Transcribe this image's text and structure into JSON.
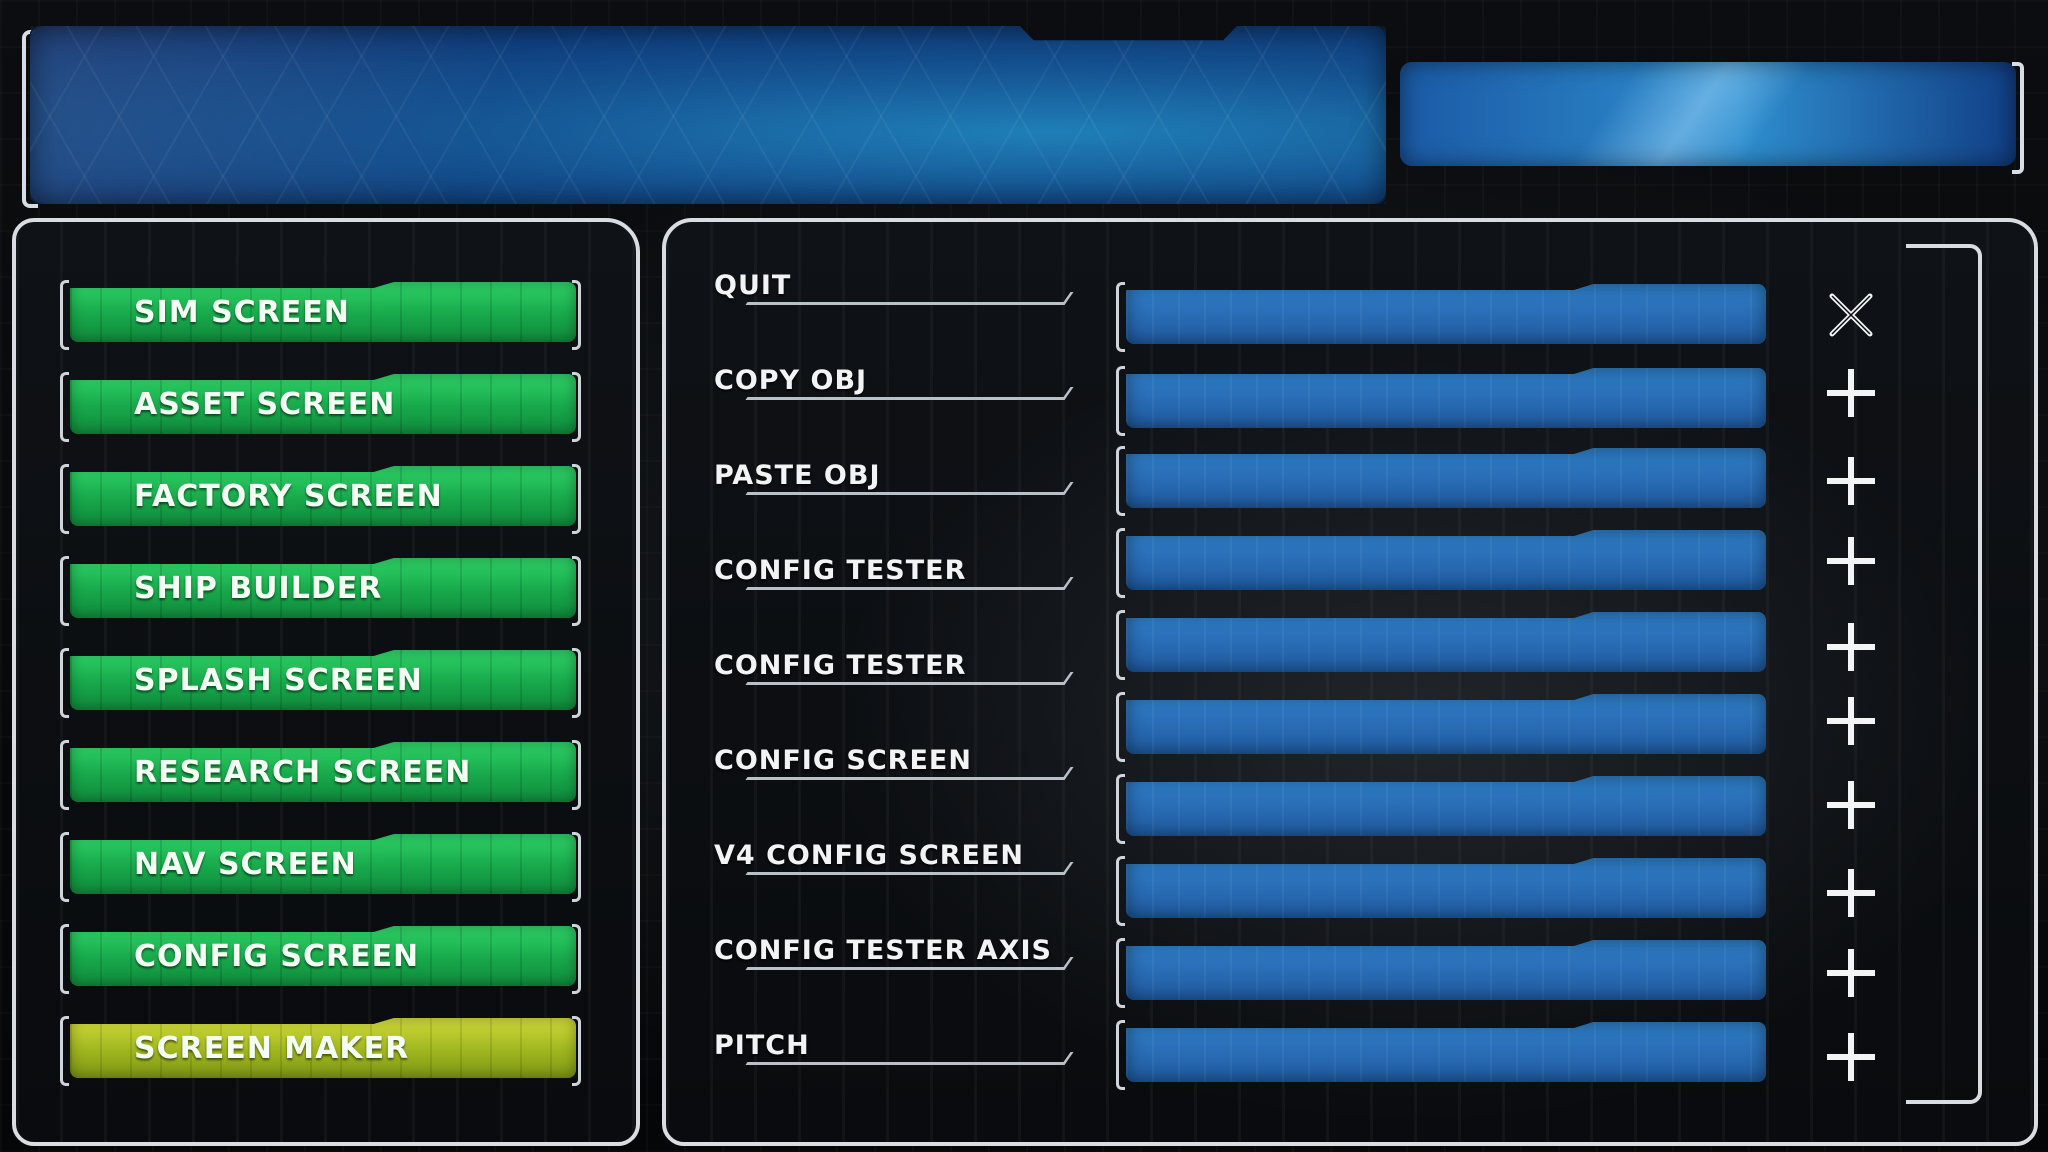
{
  "nav": {
    "items": [
      {
        "label": "SIM SCREEN",
        "active": false
      },
      {
        "label": "ASSET SCREEN",
        "active": false
      },
      {
        "label": "FACTORY SCREEN",
        "active": false
      },
      {
        "label": "SHIP BUILDER",
        "active": false
      },
      {
        "label": "SPLASH SCREEN",
        "active": false
      },
      {
        "label": "RESEARCH SCREEN",
        "active": false
      },
      {
        "label": "NAV SCREEN",
        "active": false
      },
      {
        "label": "CONFIG SCREEN",
        "active": false
      },
      {
        "label": "SCREEN MAKER",
        "active": true
      }
    ]
  },
  "rows": [
    {
      "label": "QUIT",
      "icon": "close-icon"
    },
    {
      "label": "COPY OBJ",
      "icon": "plus-icon"
    },
    {
      "label": "PASTE OBJ",
      "icon": "plus-icon"
    },
    {
      "label": "CONFIG TESTER",
      "icon": "plus-icon"
    },
    {
      "label": "CONFIG TESTER",
      "icon": "plus-icon"
    },
    {
      "label": "CONFIG SCREEN",
      "icon": "plus-icon"
    },
    {
      "label": "V4 CONFIG SCREEN",
      "icon": "plus-icon"
    },
    {
      "label": "CONFIG TESTER AXIS",
      "icon": "plus-icon"
    },
    {
      "label": "PITCH",
      "icon": "plus-icon"
    }
  ],
  "colors": {
    "nav_green": "#18a84b",
    "nav_active": "#9fb51f",
    "field_blue": "#2a6fb8",
    "frame": "#d9dde2"
  }
}
